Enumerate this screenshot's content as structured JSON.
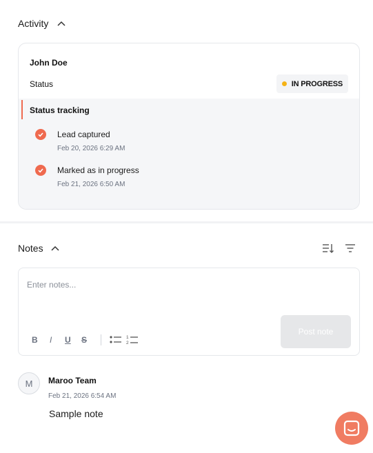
{
  "activity": {
    "title": "Activity",
    "lead_name": "John Doe",
    "status_label": "Status",
    "status_badge": "IN PROGRESS",
    "status_color": "#f5b316",
    "tracking_title": "Status tracking",
    "steps": [
      {
        "label": "Lead captured",
        "time": "Feb 20, 2026 6:29 AM"
      },
      {
        "label": "Marked as in progress",
        "time": "Feb 21, 2026 6:50 AM"
      }
    ],
    "accent_color": "#ef6a4f"
  },
  "notes": {
    "title": "Notes",
    "placeholder": "Enter notes...",
    "value": "",
    "format": {
      "bold": "B",
      "italic": "I",
      "underline": "U",
      "strike": "S"
    },
    "post_label": "Post note",
    "icons": [
      "sort-icon",
      "filter-icon",
      "bullet-list-icon",
      "numbered-list-icon"
    ],
    "items": [
      {
        "avatar": "M",
        "author": "Maroo Team",
        "time": "Feb 21, 2026 6:54 AM",
        "body": "Sample note"
      }
    ]
  },
  "chat": {
    "icon": "chat-icon",
    "color": "#f07c62"
  }
}
